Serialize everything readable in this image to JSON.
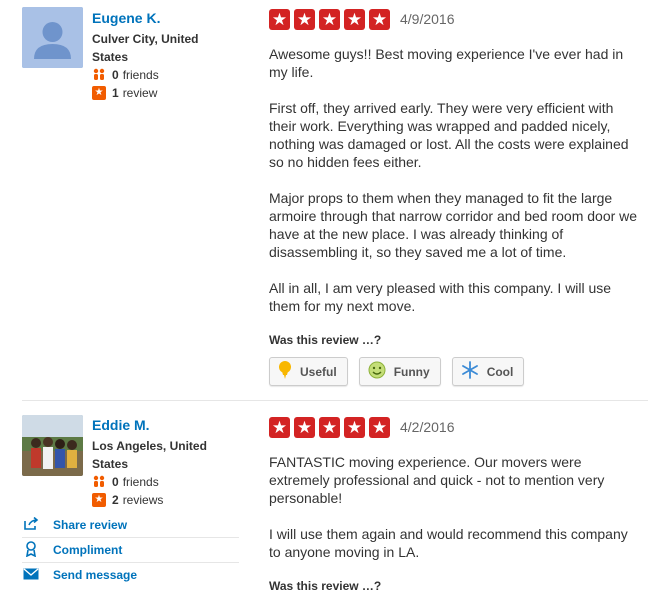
{
  "reviews": [
    {
      "user": {
        "name": "Eugene K.",
        "location": "Culver City, United States",
        "friends_count": "0",
        "friends_label": "friends",
        "reviews_count": "1",
        "reviews_label": "review"
      },
      "rating": 5,
      "date": "4/9/2016",
      "paragraphs": [
        "Awesome guys!! Best moving experience I've ever had in my life.",
        "First off, they arrived early. They were very efficient with their work. Everything was wrapped and padded nicely, nothing was damaged or lost. All the costs were explained so no hidden fees either.",
        "Major props to them when they managed to fit the large armoire through that narrow corridor and bed room door we have at the new place. I was already thinking of disassembling it, so they saved me a lot of time.",
        "All in all, I am very pleased with this company. I will use them for my next move."
      ],
      "was_useful_label": "Was this review …?",
      "votes": {
        "useful": "Useful",
        "funny": "Funny",
        "cool": "Cool"
      }
    },
    {
      "user": {
        "name": "Eddie M.",
        "location": "Los Angeles, United States",
        "friends_count": "0",
        "friends_label": "friends",
        "reviews_count": "2",
        "reviews_label": "reviews"
      },
      "rating": 5,
      "date": "4/2/2016",
      "paragraphs": [
        "FANTASTIC moving experience. Our movers were extremely professional and quick - not to mention very personable!",
        "I will use them again and would recommend this company to anyone moving in LA."
      ],
      "was_useful_label": "Was this review …?"
    }
  ],
  "actions": {
    "share": "Share review",
    "compliment": "Compliment",
    "message": "Send message"
  },
  "colors": {
    "star_red": "#d32323",
    "link_blue": "#0073bb",
    "badge_orange": "#f15c00"
  }
}
